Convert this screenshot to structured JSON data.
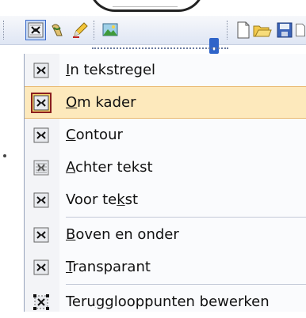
{
  "menu": {
    "items": [
      {
        "label": "In tekstregel",
        "underline": "I",
        "icon": "wrap-inline-icon"
      },
      {
        "label": "Om kader",
        "underline": "O",
        "icon": "wrap-square-icon",
        "selected": true
      },
      {
        "label": "Contour",
        "underline": "C",
        "icon": "wrap-tight-icon"
      },
      {
        "label": "Achter tekst",
        "underline": "A",
        "icon": "wrap-behind-text-icon"
      },
      {
        "label": "Voor tekst",
        "underline": "k",
        "icon": "wrap-in-front-icon"
      },
      {
        "label": "Boven en onder",
        "underline": "B",
        "icon": "wrap-top-bottom-icon"
      },
      {
        "label": "Transparant",
        "underline": "T",
        "icon": "wrap-through-icon"
      },
      {
        "label": "Terugglooppunten bewerken",
        "underline": "g",
        "icon": "edit-wrap-points-icon"
      }
    ]
  },
  "toolbar": {
    "buttons": [
      "text-wrapping-icon",
      "paint-icon",
      "pencil-icon",
      "image-icon",
      "new-document-icon",
      "open-folder-icon",
      "save-icon"
    ]
  },
  "colors": {
    "selected_bg": "#fde9bc",
    "selected_border": "#e9b86d",
    "toolbar_bg": "#dfe6f4",
    "accent": "#2f64c9"
  }
}
